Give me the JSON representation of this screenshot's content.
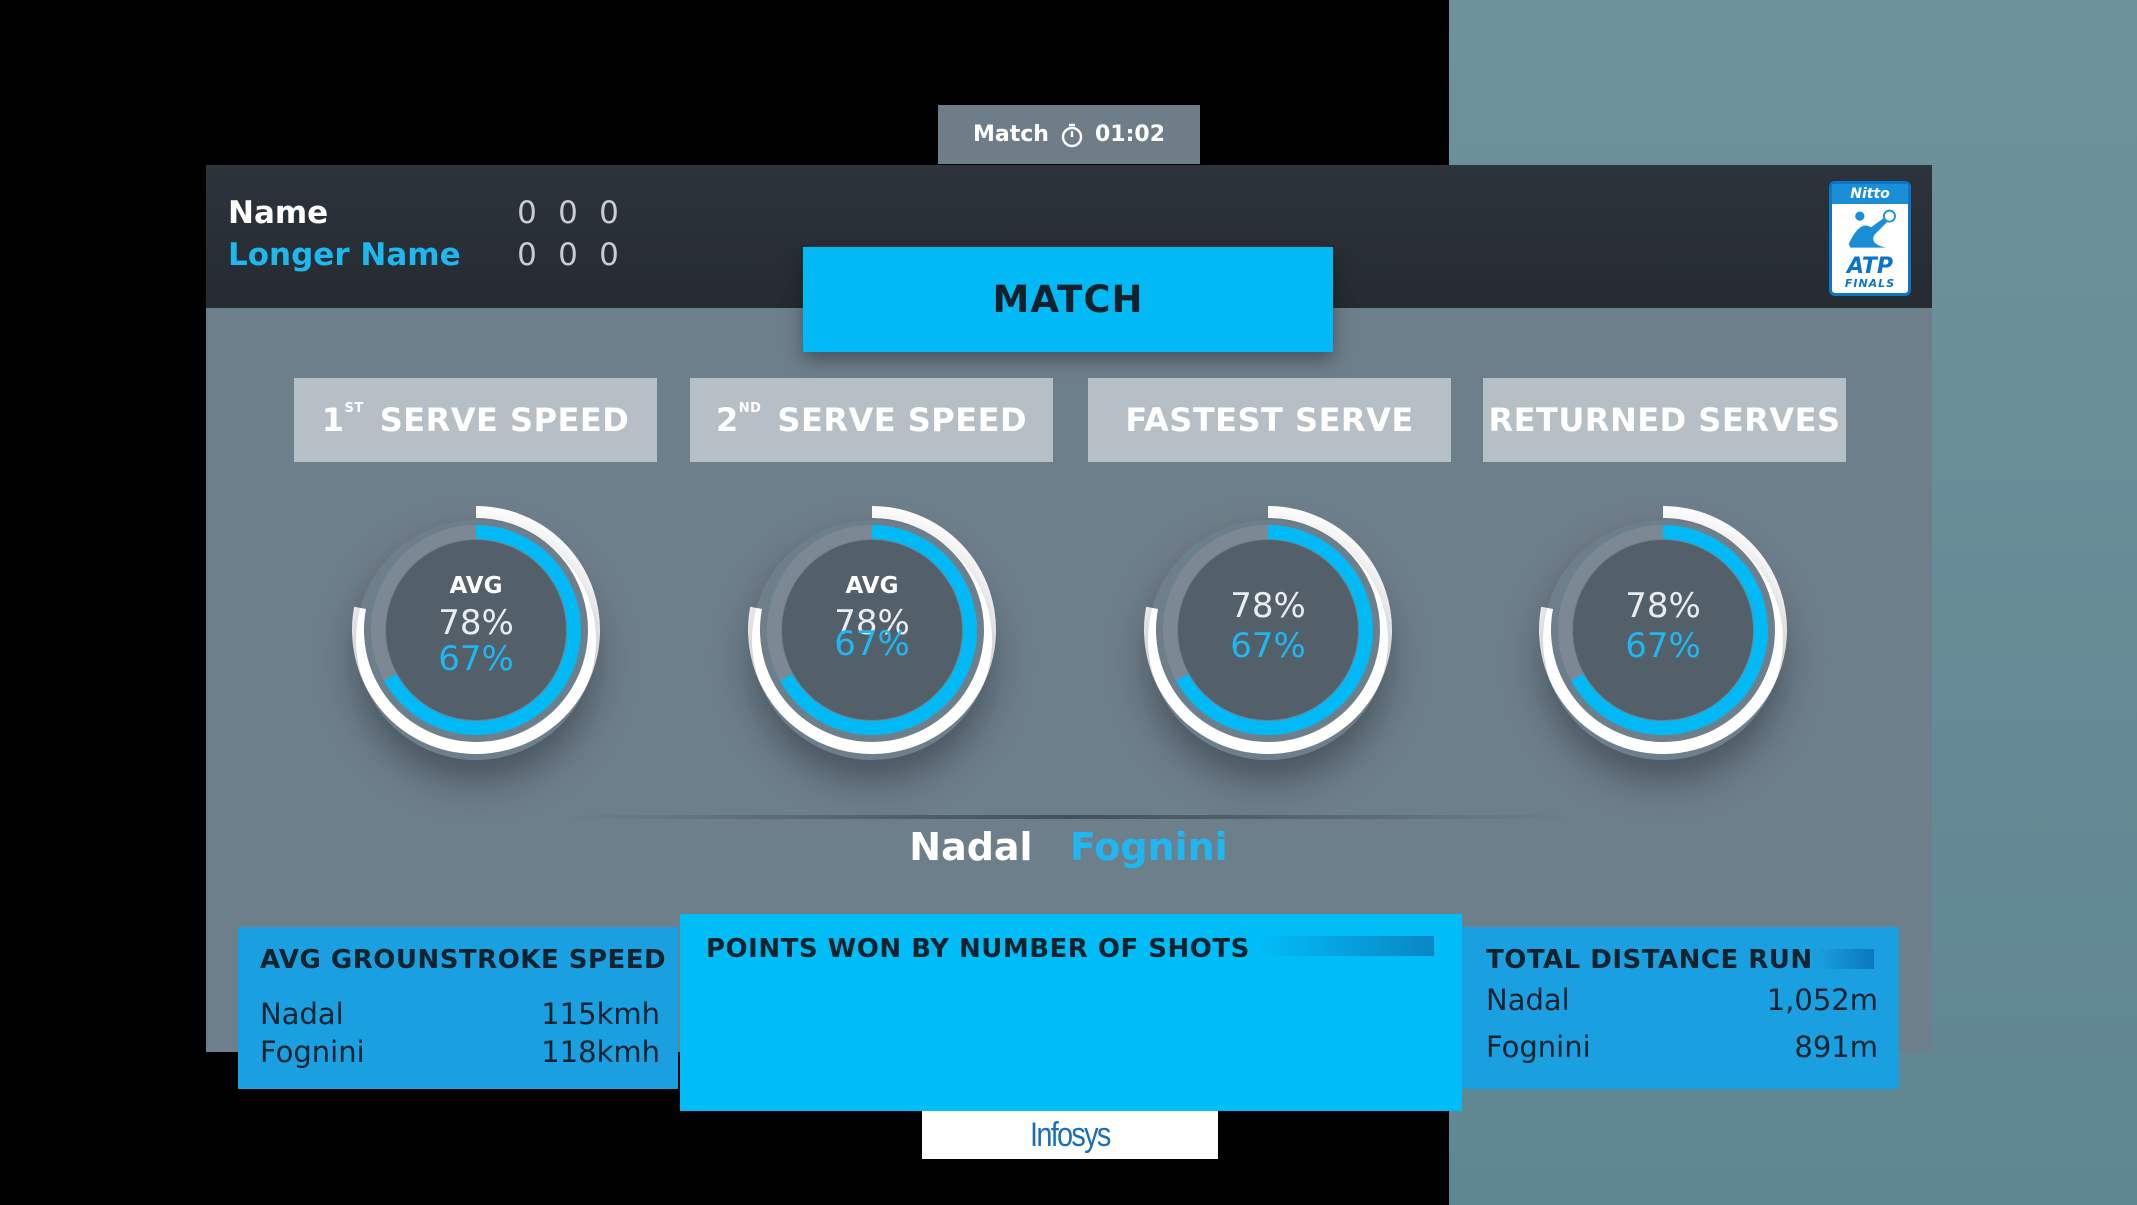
{
  "timer": {
    "label": "Match",
    "time": "01:02",
    "icon": "stopwatch-icon"
  },
  "scoreboard": {
    "players": [
      {
        "name": "Name",
        "scores": [
          "0",
          "0",
          "0"
        ],
        "color": "#ffffff"
      },
      {
        "name": "Longer Name",
        "scores": [
          "0",
          "0",
          "0"
        ],
        "color": "#1fb7f0"
      }
    ]
  },
  "logo": {
    "top": "Nitto",
    "brand": "ATP",
    "bottom": "FINALS"
  },
  "banner": {
    "title": "MATCH"
  },
  "tabs": [
    {
      "ordinal": "1",
      "sup": "ST",
      "label": "SERVE SPEED"
    },
    {
      "ordinal": "2",
      "sup": "ND",
      "label": "SERVE SPEED"
    },
    {
      "ordinal": "",
      "sup": "",
      "label": "FASTEST SERVE"
    },
    {
      "ordinal": "",
      "sup": "",
      "label": "RETURNED SERVES"
    }
  ],
  "rings": [
    {
      "caption": "AVG",
      "value_a": "78%",
      "value_b": "67%",
      "fill_white": 0.78,
      "fill_blue": 0.67
    },
    {
      "caption": "AVG",
      "value_a": "78%",
      "value_b": "67%",
      "fill_white": 0.78,
      "fill_blue": 0.67
    },
    {
      "caption": "",
      "value_a": "78%",
      "value_b": "67%",
      "fill_white": 0.78,
      "fill_blue": 0.67
    },
    {
      "caption": "",
      "value_a": "78%",
      "value_b": "67%",
      "fill_white": 0.78,
      "fill_blue": 0.67
    }
  ],
  "matchup": {
    "player_1": "Nadal",
    "player_2": "Fognini"
  },
  "groundstroke": {
    "title": "AVG GROUNSTROKE SPEED",
    "rows": [
      {
        "name": "Nadal",
        "value": "115kmh"
      },
      {
        "name": "Fognini",
        "value": "118kmh"
      }
    ]
  },
  "points": {
    "title": "POINTS WON BY NUMBER OF SHOTS"
  },
  "distance": {
    "title": "TOTAL DISTANCE RUN",
    "rows": [
      {
        "name": "Nadal",
        "value": "1,052m"
      },
      {
        "name": "Fognini",
        "value": "891m"
      }
    ]
  },
  "sponsor": {
    "name": "Infosys"
  },
  "colors": {
    "accent": "#00b9f5",
    "player_2": "#1fb7f0",
    "panel": "#6e7f8c",
    "header": "#2a3137"
  }
}
